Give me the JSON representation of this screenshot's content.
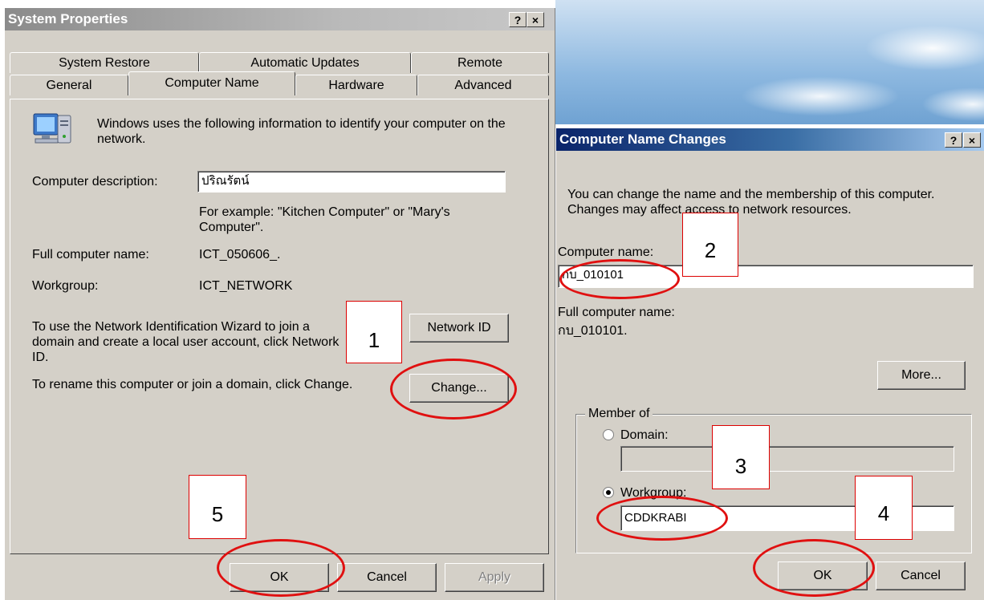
{
  "system_properties": {
    "title": "System Properties",
    "help_btn": "?",
    "close_btn": "×",
    "tabs_row1": [
      "System Restore",
      "Automatic Updates",
      "Remote"
    ],
    "tabs_row2": [
      "General",
      "Computer Name",
      "Hardware",
      "Advanced"
    ],
    "intro": "Windows uses the following information to identify your computer on the network.",
    "desc_label": "Computer description:",
    "desc_value": "ปริณรัตน์",
    "example": "For example: \"Kitchen Computer\" or \"Mary's Computer\".",
    "full_name_label": "Full computer name:",
    "full_name_value": "ICT_050606_.",
    "workgroup_label": "Workgroup:",
    "workgroup_value": "ICT_NETWORK",
    "network_id_text": "To use the Network Identification Wizard to join a domain and create a local user account, click Network ID.",
    "network_id_button": "Network ID",
    "rename_text": "To rename this computer or join a domain, click Change.",
    "change_button": "Change...",
    "ok_button": "OK",
    "cancel_button": "Cancel",
    "apply_button": "Apply"
  },
  "computer_name_changes": {
    "title": "Computer Name Changes",
    "help_btn": "?",
    "close_btn": "×",
    "intro": "You can change the name and the membership of this computer. Changes may affect access to network resources.",
    "name_label": "Computer name:",
    "name_value": "กบ_010101",
    "full_name_label": "Full computer name:",
    "full_name_value": "กบ_010101.",
    "more_button": "More...",
    "member_of_label": "Member of",
    "domain_label": "Domain:",
    "domain_value": "",
    "workgroup_label": "Workgroup:",
    "workgroup_value": "CDDKRABI",
    "ok_button": "OK",
    "cancel_button": "Cancel"
  },
  "annotations": {
    "step1": "1",
    "step2": "2",
    "step3": "3",
    "step4": "4",
    "step5": "5",
    "color": "#e01010"
  }
}
